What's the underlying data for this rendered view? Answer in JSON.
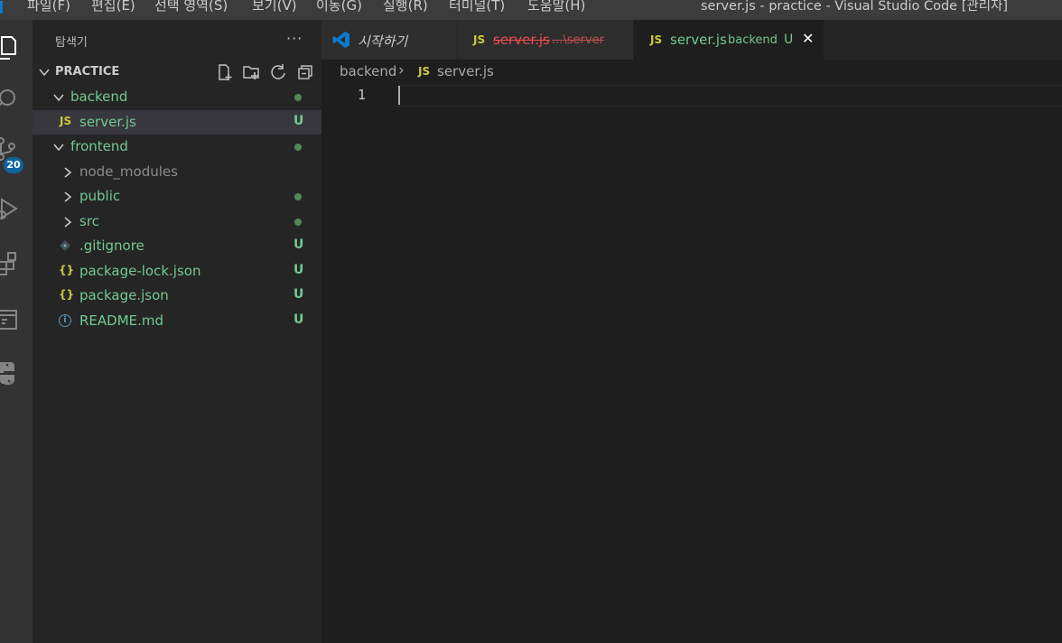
{
  "titlebar": {
    "menu": [
      "파일(F)",
      "편집(E)",
      "선택 영역(S)",
      "보기(V)",
      "이동(G)",
      "실행(R)",
      "터미널(T)",
      "도움말(H)"
    ],
    "title": "server.js - practice - Visual Studio Code [관리자]"
  },
  "activitybar": {
    "icons": [
      "explorer-icon",
      "search-icon",
      "source-control-icon",
      "run-debug-icon",
      "extensions-icon",
      "remote-explorer-icon",
      "python-icon"
    ],
    "scm_badge": "20"
  },
  "sidebar": {
    "title": "탐색기",
    "more": "···",
    "section_title": "PRACTICE",
    "header_actions": [
      "new-file-icon",
      "new-folder-icon",
      "refresh-icon",
      "collapse-all-icon"
    ],
    "tree": [
      {
        "label": "backend",
        "kind": "folder",
        "expanded": true,
        "status": "dot"
      },
      {
        "label": "server.js",
        "kind": "js",
        "icon_text": "JS",
        "status": "U",
        "selected": true
      },
      {
        "label": "frontend",
        "kind": "folder",
        "expanded": true,
        "status": "dot"
      },
      {
        "label": "node_modules",
        "kind": "folder",
        "expanded": false,
        "status": ""
      },
      {
        "label": "public",
        "kind": "folder",
        "expanded": false,
        "status": "dot"
      },
      {
        "label": "src",
        "kind": "folder",
        "expanded": false,
        "status": "dot"
      },
      {
        "label": ".gitignore",
        "kind": "git",
        "status": "U"
      },
      {
        "label": "package-lock.json",
        "kind": "json",
        "icon_text": "{}",
        "status": "U"
      },
      {
        "label": "package.json",
        "kind": "json",
        "icon_text": "{}",
        "status": "U"
      },
      {
        "label": "README.md",
        "kind": "info",
        "icon_text": "i",
        "status": "U"
      }
    ]
  },
  "tabs": [
    {
      "label": "시작하기",
      "icon": "vscode-logo-icon"
    },
    {
      "label": "server.js",
      "description": "...\\server",
      "icon_text": "JS",
      "deleted": true
    },
    {
      "label": "server.js",
      "description": "backend",
      "status": "U",
      "icon_text": "JS",
      "active": true,
      "close": "✕"
    }
  ],
  "breadcrumb": {
    "folder": "backend",
    "file_icon_text": "JS",
    "file": "server.js",
    "separator": "›"
  },
  "editor": {
    "line_number": "1"
  },
  "colors": {
    "accent": "#0e639c",
    "untracked_green": "#73c991",
    "deleted_red": "#f14c4c",
    "js_yellow": "#cbcb41"
  }
}
